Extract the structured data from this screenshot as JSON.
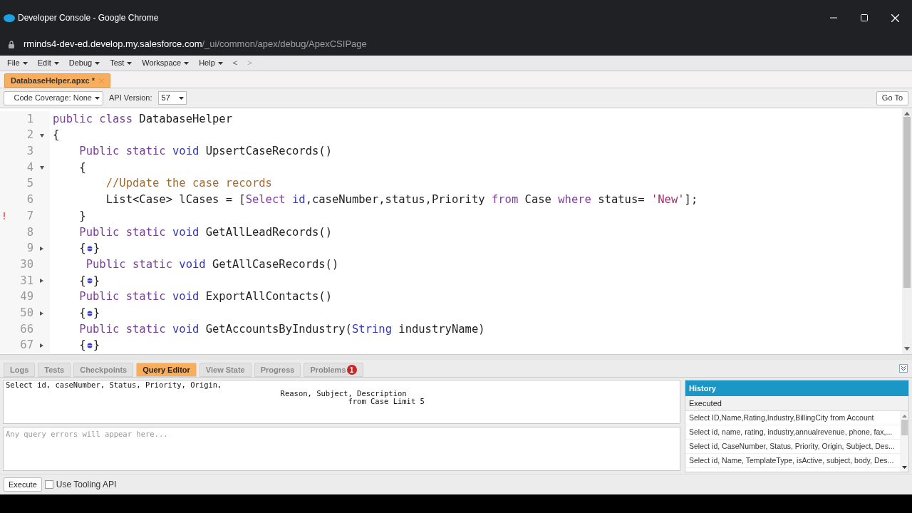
{
  "window": {
    "title": "Developer Console - Google Chrome",
    "url_host": "rminds4-dev-ed.develop.my.salesforce.com",
    "url_path": "/_ui/common/apex/debug/ApexCSIPage"
  },
  "menu": [
    "File",
    "Edit",
    "Debug",
    "Test",
    "Workspace",
    "Help"
  ],
  "nav": [
    "<",
    ">"
  ],
  "file_tabs": [
    {
      "label": "DatabaseHelper.apxc *",
      "selected": true
    }
  ],
  "toolbar": {
    "coverage": "Code Coverage: None",
    "api_label": "API Version:",
    "api_value": "57",
    "goto": "Go To"
  },
  "code": [
    {
      "number": "1",
      "tokens": [
        {
          "kind": "kw",
          "text": "public class "
        },
        {
          "kind": "plain",
          "text": "DatabaseHelper"
        }
      ]
    },
    {
      "number": "2",
      "expanded": true,
      "tokens": [
        {
          "kind": "plain",
          "text": "{"
        }
      ]
    },
    {
      "number": "3",
      "tokens": [
        {
          "kind": "kw",
          "text": "    Public static "
        },
        {
          "kind": "type",
          "text": "void "
        },
        {
          "kind": "plain",
          "text": "UpsertCaseRecords()"
        }
      ]
    },
    {
      "number": "4",
      "expanded": true,
      "tokens": [
        {
          "kind": "plain",
          "text": "    {"
        }
      ]
    },
    {
      "number": "5",
      "tokens": [
        {
          "kind": "comment",
          "text": "        //Update the case records"
        }
      ]
    },
    {
      "number": "6",
      "tokens": [
        {
          "kind": "plain",
          "text": "        List<Case> lCases = ["
        },
        {
          "kind": "kw",
          "text": "Select "
        },
        {
          "kind": "type",
          "text": "id"
        },
        {
          "kind": "plain",
          "text": ",caseNumber,status,Priority "
        },
        {
          "kind": "kw",
          "text": "from "
        },
        {
          "kind": "plain",
          "text": "Case "
        },
        {
          "kind": "kw",
          "text": "where "
        },
        {
          "kind": "plain",
          "text": "status= "
        },
        {
          "kind": "string",
          "text": "'New'"
        },
        {
          "kind": "plain",
          "text": "];"
        }
      ]
    },
    {
      "number": "7",
      "marker": "!",
      "tokens": [
        {
          "kind": "plain",
          "text": "    }"
        }
      ]
    },
    {
      "number": "8",
      "tokens": [
        {
          "kind": "kw",
          "text": "    Public static "
        },
        {
          "kind": "type",
          "text": "void "
        },
        {
          "kind": "plain",
          "text": "GetAllLeadRecords()"
        }
      ]
    },
    {
      "number": "9",
      "expanded": false,
      "tokens": [
        {
          "kind": "plain",
          "text": "    {"
        },
        {
          "kind": "fold"
        },
        {
          "kind": "plain",
          "text": "}"
        }
      ]
    },
    {
      "number": "30",
      "tokens": [
        {
          "kind": "kw",
          "text": "     Public static "
        },
        {
          "kind": "type",
          "text": "void "
        },
        {
          "kind": "plain",
          "text": "GetAllCaseRecords()"
        }
      ]
    },
    {
      "number": "31",
      "expanded": false,
      "tokens": [
        {
          "kind": "plain",
          "text": "    {"
        },
        {
          "kind": "fold"
        },
        {
          "kind": "plain",
          "text": "}"
        }
      ]
    },
    {
      "number": "49",
      "tokens": [
        {
          "kind": "kw",
          "text": "    Public static "
        },
        {
          "kind": "type",
          "text": "void "
        },
        {
          "kind": "plain",
          "text": "ExportAllContacts()"
        }
      ]
    },
    {
      "number": "50",
      "expanded": false,
      "tokens": [
        {
          "kind": "plain",
          "text": "    {"
        },
        {
          "kind": "fold"
        },
        {
          "kind": "plain",
          "text": "}"
        }
      ]
    },
    {
      "number": "66",
      "tokens": [
        {
          "kind": "kw",
          "text": "    Public static "
        },
        {
          "kind": "type",
          "text": "void "
        },
        {
          "kind": "plain",
          "text": "GetAccountsByIndustry("
        },
        {
          "kind": "type",
          "text": "String "
        },
        {
          "kind": "plain",
          "text": "industryName)"
        }
      ]
    },
    {
      "number": "67",
      "expanded": false,
      "tokens": [
        {
          "kind": "plain",
          "text": "    {"
        },
        {
          "kind": "fold"
        },
        {
          "kind": "plain",
          "text": "}"
        }
      ]
    }
  ],
  "bottom_tabs": [
    {
      "label": "Logs",
      "selected": false
    },
    {
      "label": "Tests",
      "selected": false
    },
    {
      "label": "Checkpoints",
      "selected": false
    },
    {
      "label": "Query Editor",
      "selected": true
    },
    {
      "label": "View State",
      "selected": false
    },
    {
      "label": "Progress",
      "selected": false
    },
    {
      "label": "Problems",
      "selected": false,
      "badge": "1"
    }
  ],
  "query": {
    "lines": [
      "Select id, caseNumber, Status, Priority, Origin,",
      "                                                             Reason, Subject, Description",
      "                                                                            from Case Limit 5"
    ],
    "errors_placeholder": "Any query errors will appear here..."
  },
  "history": {
    "title": "History",
    "column": "Executed",
    "rows": [
      "Select ID,Name,Rating,Industry,BillingCity from Account",
      "Select id, name, rating, industry,annualrevenue, phone, fax,...",
      "Select id, CaseNumber, Status, Priority, Origin, Subject, Des...",
      "Select id, Name, TemplateType, isActive, subject, body, Des..."
    ]
  },
  "execute": "Execute",
  "tooling": {
    "label": "Use Tooling API",
    "checked": false
  }
}
